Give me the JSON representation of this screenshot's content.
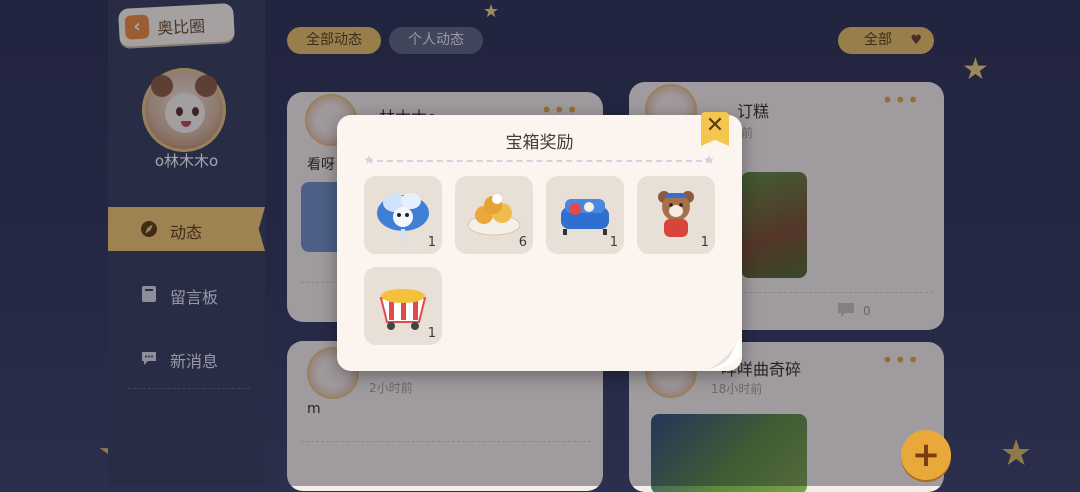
{
  "header": {
    "back_label": "奥比圈",
    "tabs": [
      {
        "label": "全部动态",
        "active": true
      },
      {
        "label": "个人动态",
        "active": false
      }
    ],
    "filter_label": "全部"
  },
  "profile": {
    "username": "o林木木o"
  },
  "sidebar": {
    "items": [
      {
        "label": "动态",
        "icon": "compass-icon",
        "active": true
      },
      {
        "label": "留言板",
        "icon": "notebook-icon",
        "active": false
      },
      {
        "label": "新消息",
        "icon": "chat-bubble-icon",
        "active": false
      }
    ]
  },
  "feed": {
    "cards": [
      {
        "name": "林木木o",
        "caption": "看呀"
      },
      {
        "name": "订糕",
        "time": "前"
      },
      {
        "text": "m",
        "time": "2小时前"
      },
      {
        "name": "咩咩曲奇碎",
        "time": "18小时前"
      }
    ],
    "comment_count": "0"
  },
  "modal": {
    "title": "宝箱奖励",
    "items": [
      {
        "icon": "cloud-creature-icon",
        "count": "1"
      },
      {
        "icon": "dessert-plate-icon",
        "count": "6"
      },
      {
        "icon": "blue-sofa-icon",
        "count": "1"
      },
      {
        "icon": "bear-costume-icon",
        "count": "1"
      },
      {
        "icon": "popcorn-cart-icon",
        "count": "1"
      }
    ],
    "close_label": "✕"
  },
  "actions": {
    "add_label": "+"
  },
  "colors": {
    "accent": "#e7bf60",
    "background": "#2f3456",
    "panel": "#fbf4ef"
  }
}
